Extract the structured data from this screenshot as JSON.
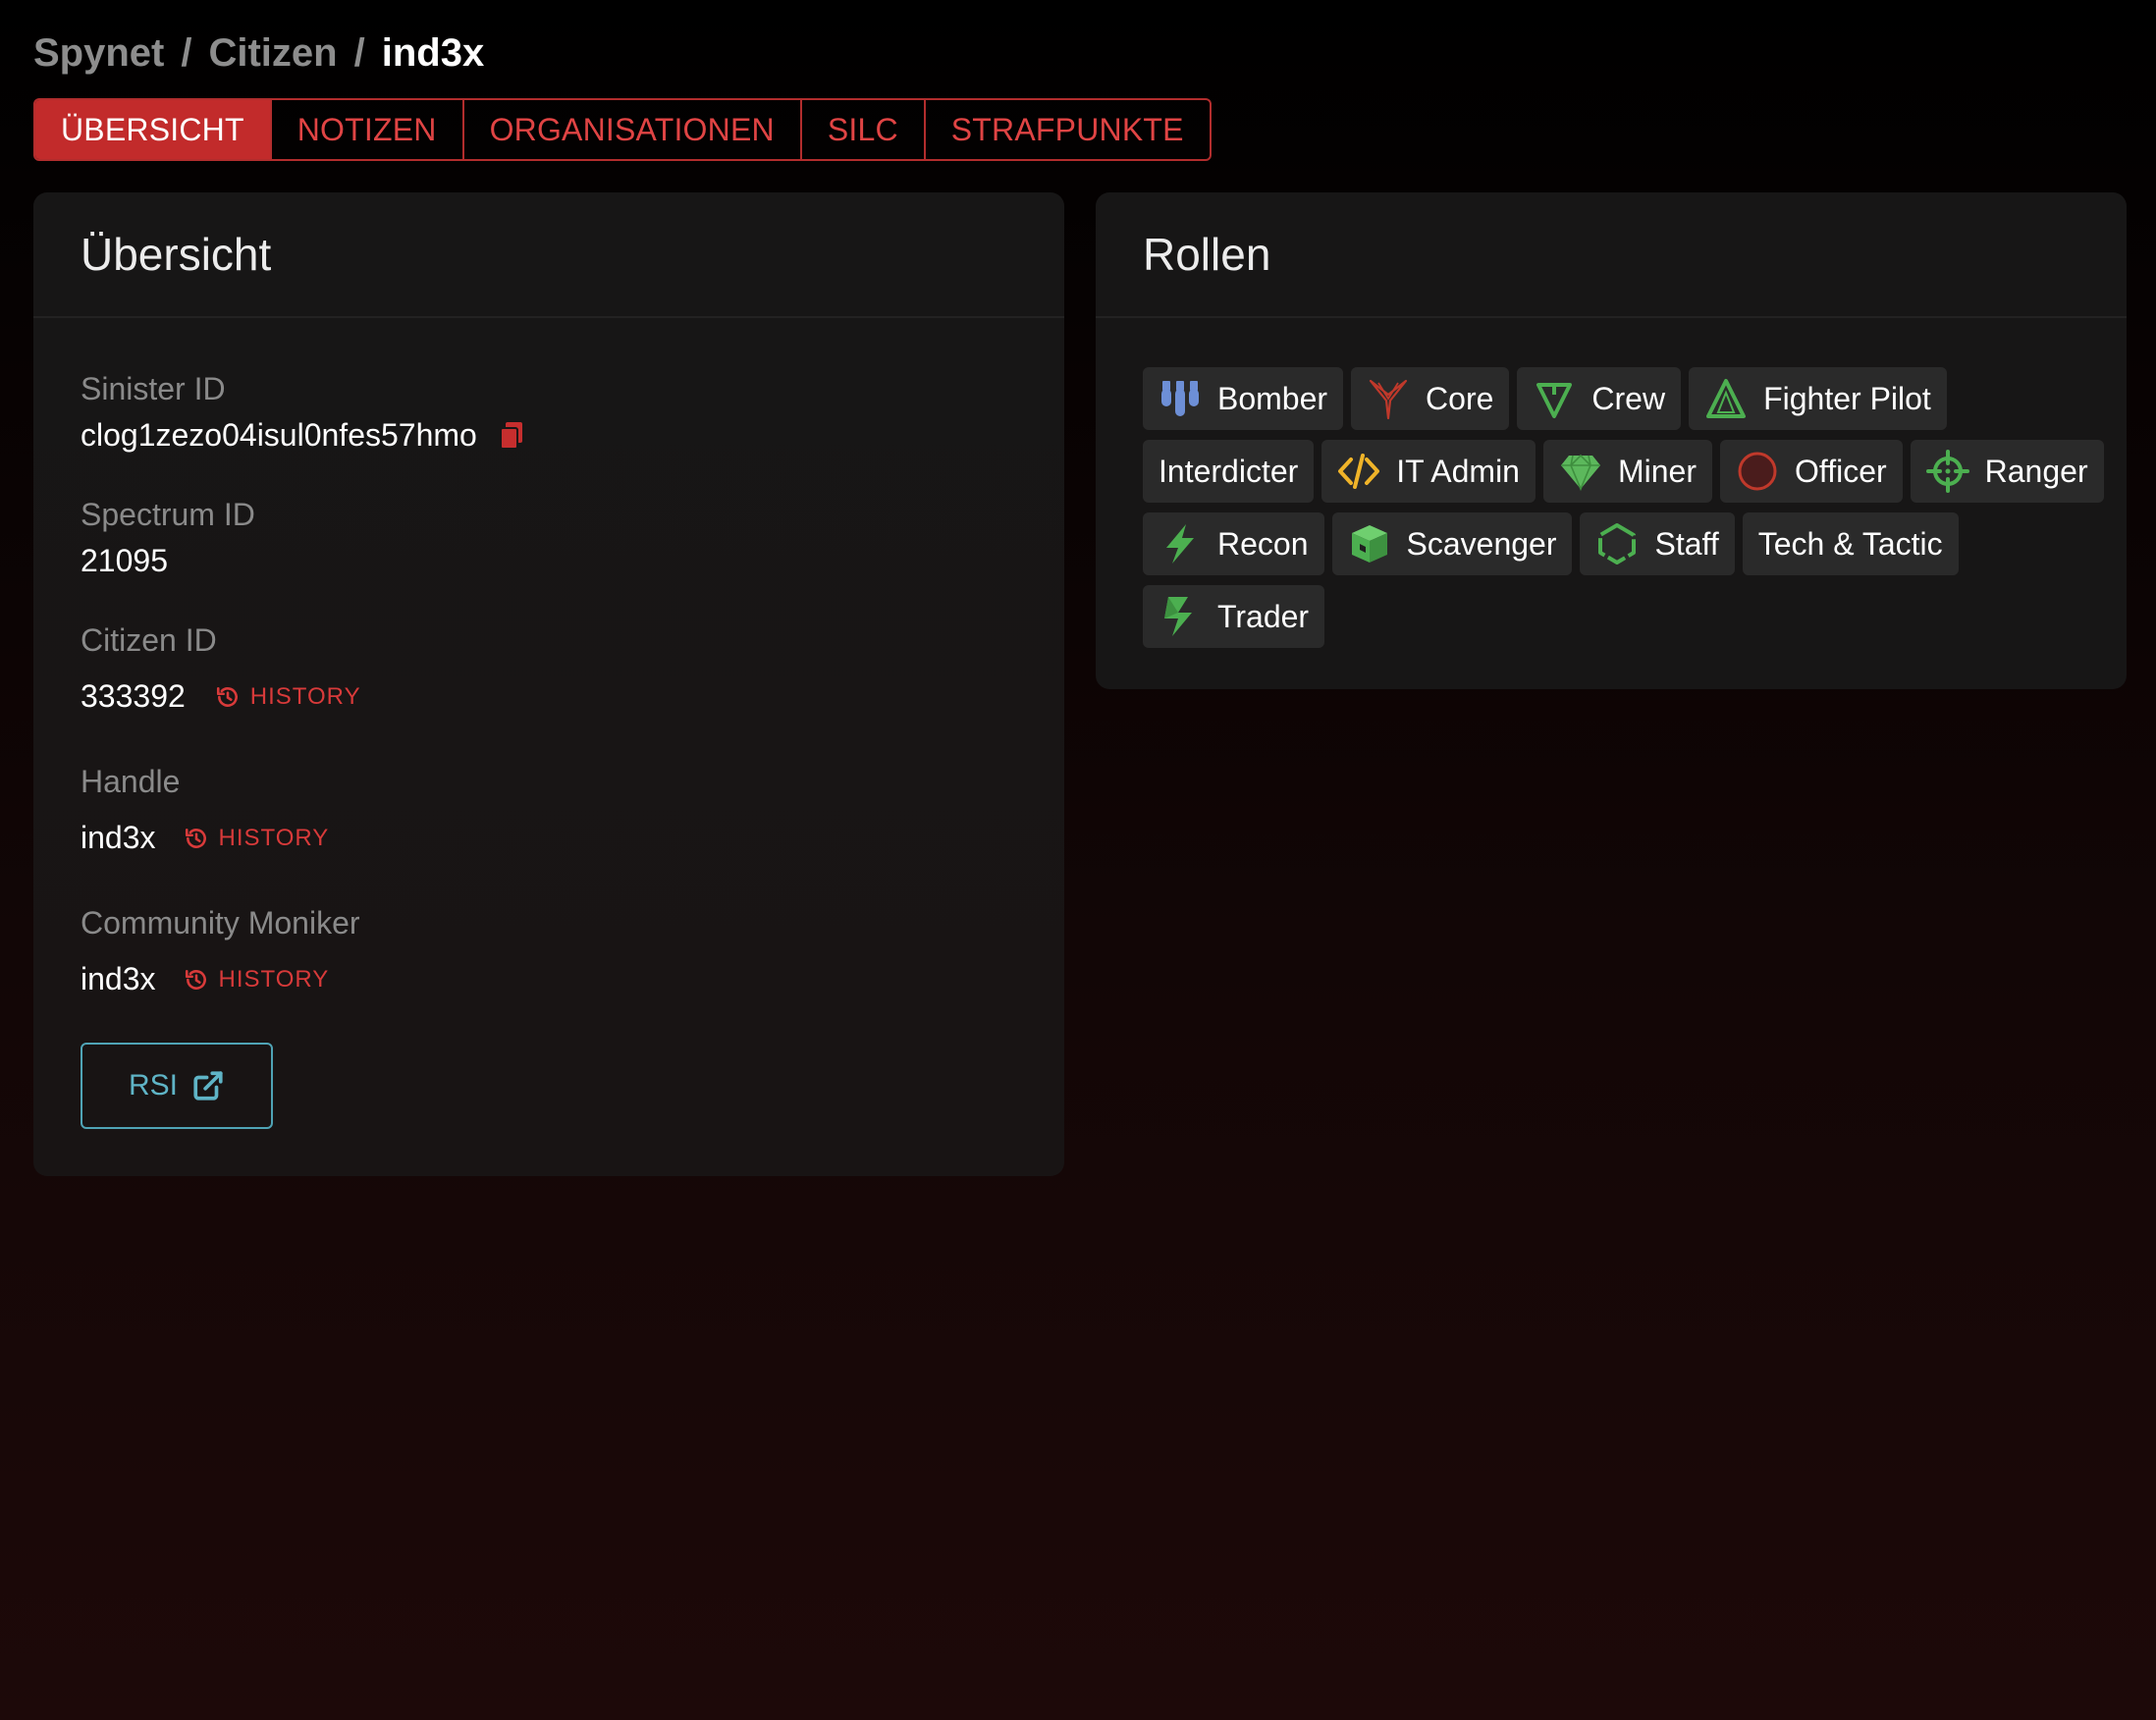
{
  "breadcrumb": {
    "items": [
      "Spynet",
      "Citizen",
      "ind3x"
    ],
    "separator": "/"
  },
  "tabs": [
    {
      "label": "ÜBERSICHT",
      "active": true
    },
    {
      "label": "NOTIZEN",
      "active": false
    },
    {
      "label": "ORGANISATIONEN",
      "active": false
    },
    {
      "label": "SILC",
      "active": false
    },
    {
      "label": "STRAFPUNKTE",
      "active": false
    }
  ],
  "overview": {
    "title": "Übersicht",
    "sinister_id": {
      "label": "Sinister ID",
      "value": "clog1zezo04isul0nfes57hmo"
    },
    "spectrum_id": {
      "label": "Spectrum ID",
      "value": "21095"
    },
    "citizen_id": {
      "label": "Citizen ID",
      "value": "333392",
      "history_label": "HISTORY"
    },
    "handle": {
      "label": "Handle",
      "value": "ind3x",
      "history_label": "HISTORY"
    },
    "moniker": {
      "label": "Community Moniker",
      "value": "ind3x",
      "history_label": "HISTORY"
    },
    "rsi_button": "RSI"
  },
  "roles": {
    "title": "Rollen",
    "items": [
      {
        "label": "Bomber",
        "icon": "bomb-icon",
        "color": "#6d8fd6"
      },
      {
        "label": "Core",
        "icon": "core-icon",
        "color": "#c0392b"
      },
      {
        "label": "Crew",
        "icon": "crew-icon",
        "color": "#4caf50"
      },
      {
        "label": "Fighter Pilot",
        "icon": "fighter-icon",
        "color": "#4caf50"
      },
      {
        "label": "Interdicter",
        "icon": "",
        "color": ""
      },
      {
        "label": "IT Admin",
        "icon": "code-icon",
        "color": "#f0b429"
      },
      {
        "label": "Miner",
        "icon": "gem-icon",
        "color": "#5cb85c"
      },
      {
        "label": "Officer",
        "icon": "circle-icon",
        "color": "#c0392b"
      },
      {
        "label": "Ranger",
        "icon": "crosshair-icon",
        "color": "#4caf50"
      },
      {
        "label": "Recon",
        "icon": "bolt-icon",
        "color": "#4caf50"
      },
      {
        "label": "Scavenger",
        "icon": "box-icon",
        "color": "#4caf50"
      },
      {
        "label": "Staff",
        "icon": "hexagon-icon",
        "color": "#4caf50"
      },
      {
        "label": "Tech & Tactic",
        "icon": "",
        "color": ""
      },
      {
        "label": "Trader",
        "icon": "trader-icon",
        "color": "#4caf50"
      }
    ]
  },
  "colors": {
    "accent": "#c22b2b",
    "history": "#d83a3a",
    "link": "#5fb4c6"
  }
}
